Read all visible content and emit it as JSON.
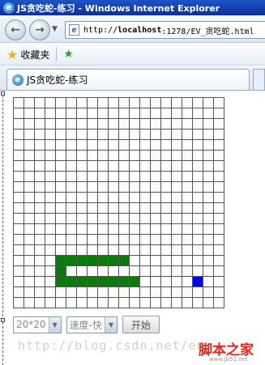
{
  "window": {
    "title": "JS贪吃蛇-练习 - Windows Internet Explorer"
  },
  "navigation": {
    "back_icon": "back-arrow-icon",
    "forward_icon": "forward-arrow-icon",
    "address_prefix": "http://",
    "address_host": "localhost",
    "address_rest": ":1278/EV_贪吃蛇.html"
  },
  "favorites": {
    "label": "收藏夹",
    "icon": "favorites-star-icon",
    "add_icon": "add-favorite-icon"
  },
  "tab": {
    "title": "JS贪吃蛇-练习"
  },
  "game": {
    "grid_size": 20,
    "snake_color": "#0a7a0a",
    "food_color": "#0000ff",
    "snake_cells": [
      [
        4,
        15
      ],
      [
        5,
        15
      ],
      [
        6,
        15
      ],
      [
        7,
        15
      ],
      [
        8,
        15
      ],
      [
        9,
        15
      ],
      [
        10,
        15
      ],
      [
        4,
        16
      ],
      [
        4,
        17
      ],
      [
        5,
        17
      ],
      [
        6,
        17
      ],
      [
        7,
        17
      ],
      [
        8,
        17
      ],
      [
        9,
        17
      ],
      [
        10,
        17
      ],
      [
        11,
        17
      ]
    ],
    "food_cells": [
      [
        17,
        17
      ]
    ]
  },
  "controls": {
    "size_select": "20*20",
    "speed_select": "速度-快",
    "start_label": "开始"
  },
  "watermark": {
    "text": "http://blog.csdn.net/en",
    "brand": "脚本之家",
    "brand_url": "www.jb51.net"
  }
}
